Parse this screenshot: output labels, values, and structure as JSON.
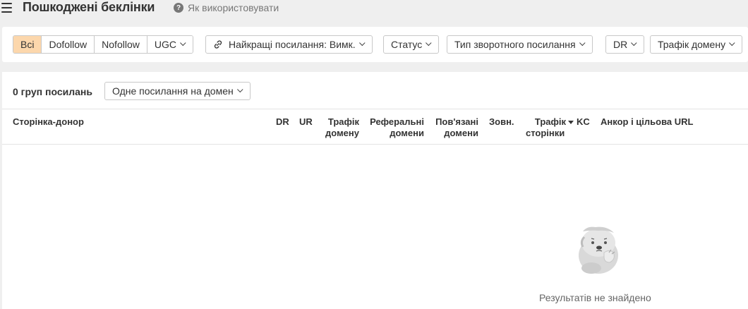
{
  "header": {
    "title": "Пошкоджені беклінки",
    "help_label": "Як використовувати"
  },
  "filters": {
    "link_types": [
      "Всі",
      "Dofollow",
      "Nofollow",
      "UGC"
    ],
    "best_links": "Найкращі посилання: Вимк.",
    "status": "Статус",
    "backlink_type": "Тип зворотного посилання",
    "dr": "DR",
    "domain_traffic": "Трафік домену"
  },
  "results": {
    "group_count": "0 груп посилань",
    "grouping_select": "Одне посилання на домен",
    "columns": {
      "referring_page": "Сторінка-донор",
      "dr": "DR",
      "ur": "UR",
      "domain_traffic_1": "Трафік",
      "domain_traffic_2": "домену",
      "ref_domains_1": "Реферальні",
      "ref_domains_2": "домени",
      "linked_domains_1": "Пов'язані",
      "linked_domains_2": "домени",
      "external": "Зовн.",
      "page_traffic_1": "Трафік",
      "page_traffic_2": "сторінки",
      "kw": "KC",
      "anchor_target": "Анкор і цільова URL"
    },
    "empty_message": "Результатів не знайдено"
  }
}
